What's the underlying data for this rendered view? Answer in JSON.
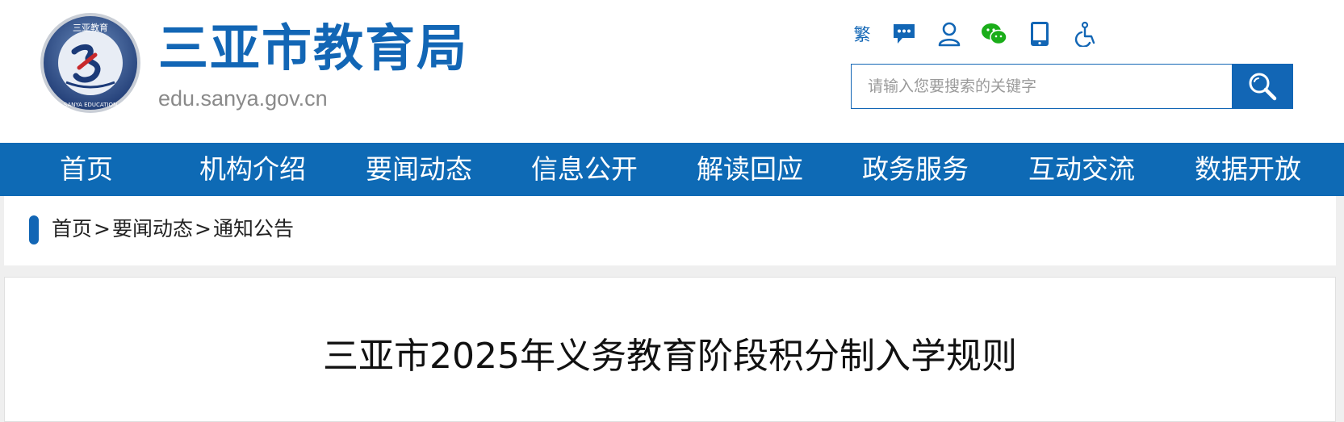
{
  "header": {
    "title": "三亚市教育局",
    "domain": "edu.sanya.gov.cn",
    "logo_text": {
      "top": "三亚教育",
      "ring": "SANYA EDUCATION"
    }
  },
  "toolbar": {
    "traditional_label": "繁",
    "icons": [
      "chat-bubble-icon",
      "user-icon",
      "wechat-icon",
      "mobile-icon",
      "accessibility-icon"
    ]
  },
  "search": {
    "placeholder": "请输入您要搜索的关键字",
    "value": ""
  },
  "nav": {
    "items": [
      "首页",
      "机构介绍",
      "要闻动态",
      "信息公开",
      "解读回应",
      "政务服务",
      "互动交流",
      "数据开放"
    ]
  },
  "breadcrumb": {
    "items": [
      "首页",
      "要闻动态",
      "通知公告"
    ],
    "separator": ">"
  },
  "article": {
    "title": "三亚市2025年义务教育阶段积分制入学规则"
  },
  "colors": {
    "brand_blue": "#1266b5",
    "nav_blue": "#0e6ab5",
    "wechat_green": "#1aad19"
  }
}
